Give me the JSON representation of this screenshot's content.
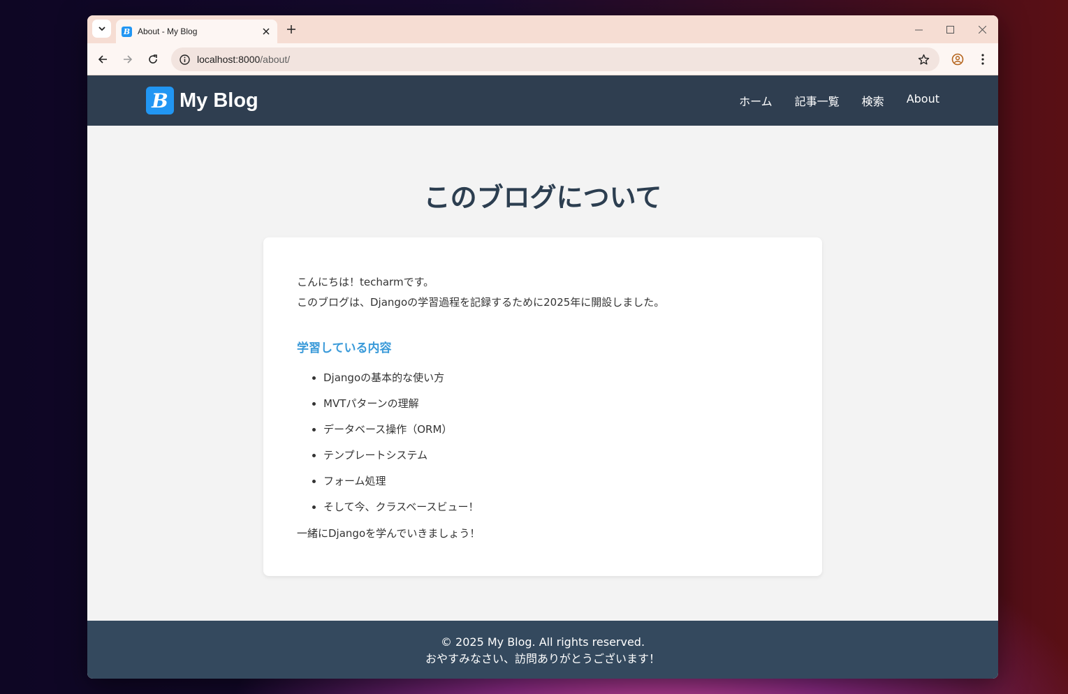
{
  "browser": {
    "tab": {
      "title": "About - My Blog",
      "favicon_letter": "B"
    },
    "url_host": "localhost:8000",
    "url_path": "/about/",
    "icons": [
      "tab-search-icon",
      "close-icon",
      "plus-icon",
      "minimize-icon",
      "maximize-icon",
      "window-close-icon",
      "back-icon",
      "forward-icon",
      "reload-icon",
      "site-info-icon",
      "star-icon",
      "profile-icon",
      "more-icon"
    ]
  },
  "site": {
    "logo_letter": "B",
    "brand": "My Blog",
    "nav": [
      {
        "label": "ホーム"
      },
      {
        "label": "記事一覧"
      },
      {
        "label": "検索"
      },
      {
        "label": "About"
      }
    ]
  },
  "about": {
    "title": "このブログについて",
    "intro_line1": "こんにちは！techarmです。",
    "intro_line2": "このブログは、Djangoの学習過程を記録するために2025年に開設しました。",
    "section_heading": "学習している内容",
    "items": [
      "Djangoの基本的な使い方",
      "MVTパターンの理解",
      "データベース操作（ORM）",
      "テンプレートシステム",
      "フォーム処理",
      "そして今、クラスベースビュー！"
    ],
    "outro": "一緒にDjangoを学んでいきましょう！"
  },
  "footer": {
    "copyright": "© 2025 My Blog. All rights reserved.",
    "message": "おやすみなさい、訪問ありがとうございます！"
  },
  "colors": {
    "header_bg": "#2f3e50",
    "footer_bg": "#34495e",
    "accent": "#3a9ad9",
    "logo_blue": "#2196f3",
    "title": "#2c3e50"
  }
}
